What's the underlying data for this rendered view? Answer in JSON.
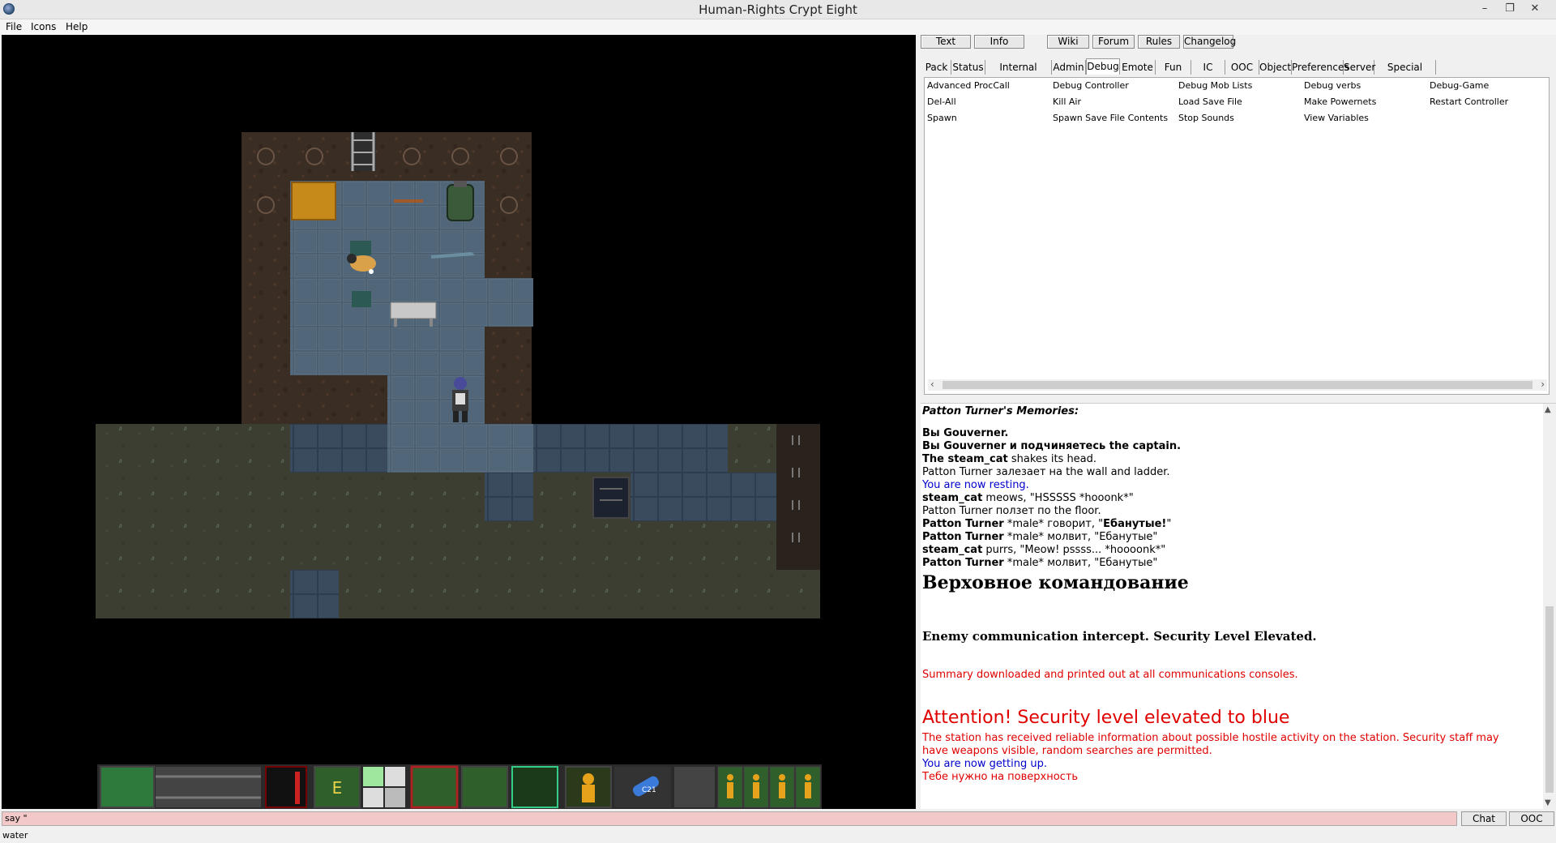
{
  "window": {
    "title": "Human-Rights Crypt Eight"
  },
  "menu": {
    "file": "File",
    "icons": "Icons",
    "help": "Help"
  },
  "top_buttons": {
    "text": "Text",
    "info": "Info",
    "wiki": "Wiki",
    "forum": "Forum",
    "rules": "Rules",
    "changelog": "Changelog"
  },
  "tabs": [
    "Pack",
    "Status",
    "Internal organs",
    "Admin",
    "Debug",
    "Emote",
    "Fun",
    "IC",
    "OOC",
    "Object",
    "Preferences",
    "Server",
    "Special Verbs"
  ],
  "active_tab": "Debug",
  "verbs": [
    [
      "Advanced ProcCall",
      "Debug Controller",
      "Debug Mob Lists",
      "Debug verbs",
      "Debug-Game"
    ],
    [
      "Del-All",
      "Kill Air",
      "Load Save File",
      "Make Powernets",
      "Restart Controller"
    ],
    [
      "Spawn",
      "Spawn Save File Contents",
      "Stop Sounds",
      "View Variables",
      ""
    ]
  ],
  "chat": {
    "memories_header": "Patton Turner's Memories:",
    "l1": "Вы Gouverner.",
    "l2": "Вы Gouverner и подчиняетесь the captain.",
    "l3_name": "The steam_cat",
    "l3_rest": " shakes its head.",
    "l4": "Patton Turner залезает на the wall and ladder.",
    "l5": "You are now resting.",
    "l6_name": "steam_cat",
    "l6_rest": " meows, \"HSSSSS *hooonk*\"",
    "l7": "Patton Turner ползет по the floor.",
    "l8_name": "Patton Turner",
    "l8_rest": "  *male* говорит, \"",
    "l8_quote": "Ебанутые!",
    "l8_end": "\"",
    "l9_name": "Patton Turner",
    "l9_rest": "  *male* молвит, \"Ебанутые\"",
    "l10_name": "steam_cat",
    "l10_rest": " purrs, \"Meow! pssss... *hoooonk*\"",
    "l11_name": "Patton Turner",
    "l11_rest": "  *male* молвит, \"Ебанутые\"",
    "command_header": "Верховное командование",
    "intercept": "Enemy communication intercept.  Security Level Elevated.",
    "summary": "Summary downloaded and printed out at all communications consoles.",
    "attention": "Attention! Security level elevated to blue",
    "station_info_1": "The station has received reliable information about possible hostile activity on the station. Security staff may",
    "station_info_2": "have weapons visible, random searches are permitted.",
    "getting_up": "You are now getting up.",
    "surface": "Тебе нужно на поверхность"
  },
  "input": {
    "value": "say \"",
    "chat_button": "Chat",
    "ooc_button": "OOC"
  },
  "status": {
    "text": "water"
  },
  "hud": {
    "intent_letter": "E",
    "tank_label": "C21"
  },
  "colors": {
    "attention_red": "#e00000",
    "info_blue": "#0000cc",
    "input_bg": "#f2c8c8"
  }
}
